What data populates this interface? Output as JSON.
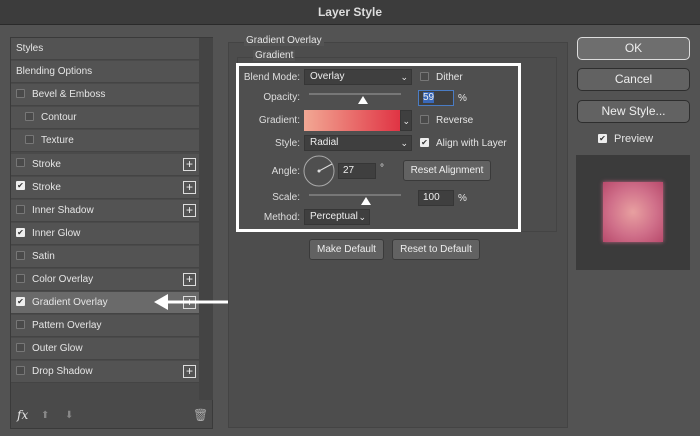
{
  "title": "Layer Style",
  "sidebar": {
    "items": [
      {
        "label": "Styles",
        "checkbox": false,
        "indent": 0,
        "plus": false
      },
      {
        "label": "Blending Options",
        "checkbox": false,
        "indent": 0,
        "plus": false
      },
      {
        "label": "Bevel & Emboss",
        "checkbox": true,
        "checked": false,
        "indent": 0,
        "plus": false
      },
      {
        "label": "Contour",
        "checkbox": true,
        "checked": false,
        "indent": 1,
        "plus": false
      },
      {
        "label": "Texture",
        "checkbox": true,
        "checked": false,
        "indent": 1,
        "plus": false
      },
      {
        "label": "Stroke",
        "checkbox": true,
        "checked": false,
        "indent": 0,
        "plus": true
      },
      {
        "label": "Stroke",
        "checkbox": true,
        "checked": true,
        "indent": 0,
        "plus": true
      },
      {
        "label": "Inner Shadow",
        "checkbox": true,
        "checked": false,
        "indent": 0,
        "plus": true
      },
      {
        "label": "Inner Glow",
        "checkbox": true,
        "checked": true,
        "indent": 0,
        "plus": false
      },
      {
        "label": "Satin",
        "checkbox": true,
        "checked": false,
        "indent": 0,
        "plus": false
      },
      {
        "label": "Color Overlay",
        "checkbox": true,
        "checked": false,
        "indent": 0,
        "plus": true
      },
      {
        "label": "Gradient Overlay",
        "checkbox": true,
        "checked": true,
        "indent": 0,
        "plus": true,
        "selected": true
      },
      {
        "label": "Pattern Overlay",
        "checkbox": true,
        "checked": false,
        "indent": 0,
        "plus": false
      },
      {
        "label": "Outer Glow",
        "checkbox": true,
        "checked": false,
        "indent": 0,
        "plus": false
      },
      {
        "label": "Drop Shadow",
        "checkbox": true,
        "checked": false,
        "indent": 0,
        "plus": true
      }
    ],
    "fx_label": "fx"
  },
  "panel": {
    "section": "Gradient Overlay",
    "group": "Gradient",
    "blend_mode_label": "Blend Mode:",
    "blend_mode": "Overlay",
    "dither_label": "Dither",
    "dither": false,
    "opacity_label": "Opacity:",
    "opacity": "59",
    "opacity_unit": "%",
    "gradient_label": "Gradient:",
    "gradient_colors": [
      "#f2a894",
      "#e03444"
    ],
    "reverse_label": "Reverse",
    "reverse": false,
    "style_label": "Style:",
    "style": "Radial",
    "align_label": "Align with Layer",
    "align": true,
    "angle_label": "Angle:",
    "angle": "27",
    "angle_unit": "°",
    "reset_alignment": "Reset Alignment",
    "scale_label": "Scale:",
    "scale": "100",
    "scale_unit": "%",
    "method_label": "Method:",
    "method": "Perceptual",
    "make_default": "Make Default",
    "reset_default": "Reset to Default"
  },
  "right": {
    "ok": "OK",
    "cancel": "Cancel",
    "new_style": "New Style...",
    "preview_label": "Preview",
    "preview": true
  }
}
